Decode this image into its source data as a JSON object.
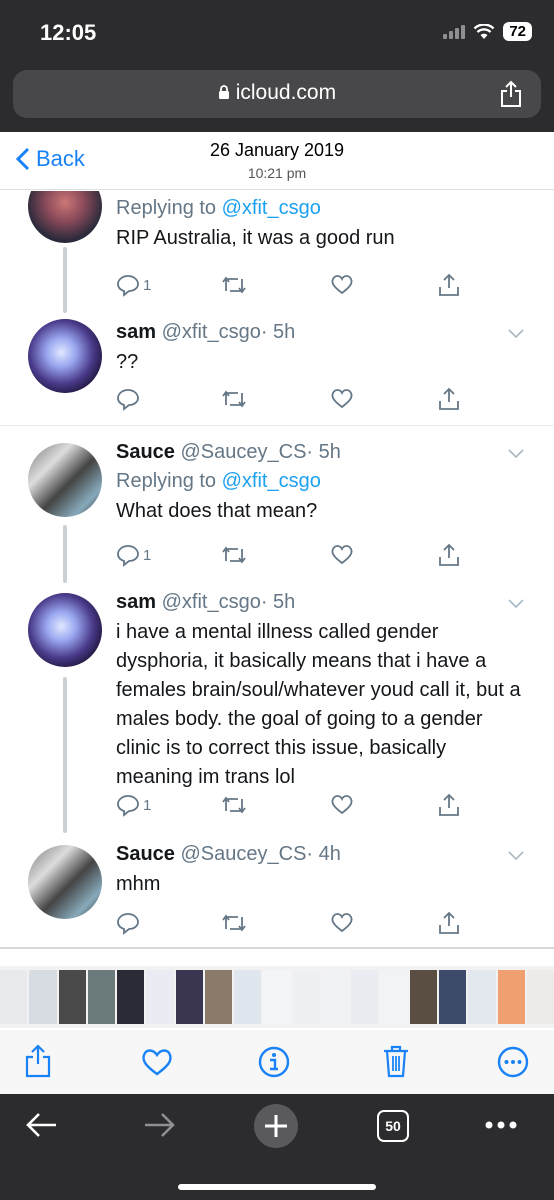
{
  "status": {
    "time": "12:05",
    "battery": "72"
  },
  "browser": {
    "url": "icloud.com"
  },
  "header": {
    "back_label": "Back",
    "date": "26 January 2019",
    "time": "10:21 pm"
  },
  "tweets": [
    {
      "name": "",
      "handle": "",
      "age": "",
      "reply_prefix": "Replying to ",
      "reply_handle": "@xfit_csgo",
      "text": "RIP Australia, it was a good run",
      "reply_count": "1"
    },
    {
      "name": "sam",
      "handle": "@xfit_csgo",
      "age": "· 5h",
      "text": "??",
      "reply_count": ""
    },
    {
      "name": "Sauce",
      "handle": "@Saucey_CS",
      "age": "· 5h",
      "reply_prefix": "Replying to ",
      "reply_handle": "@xfit_csgo",
      "text": "What does that mean?",
      "reply_count": "1"
    },
    {
      "name": "sam",
      "handle": "@xfit_csgo",
      "age": "· 5h",
      "text": "i have a mental illness called gender dysphoria, it basically means that i have a females brain/soul/whatever youd call it, but a males body. the goal of going to a gender clinic is to correct this issue, basically meaning im trans lol",
      "reply_count": "1"
    },
    {
      "name": "Sauce",
      "handle": "@Saucey_CS",
      "age": "· 4h",
      "text": "mhm",
      "reply_count": ""
    }
  ],
  "tabs": {
    "count": "50"
  },
  "colors": {
    "accent": "#1a82f7",
    "twitter_blue": "#1da1f2",
    "chrome_dark": "#2c2c2e"
  }
}
